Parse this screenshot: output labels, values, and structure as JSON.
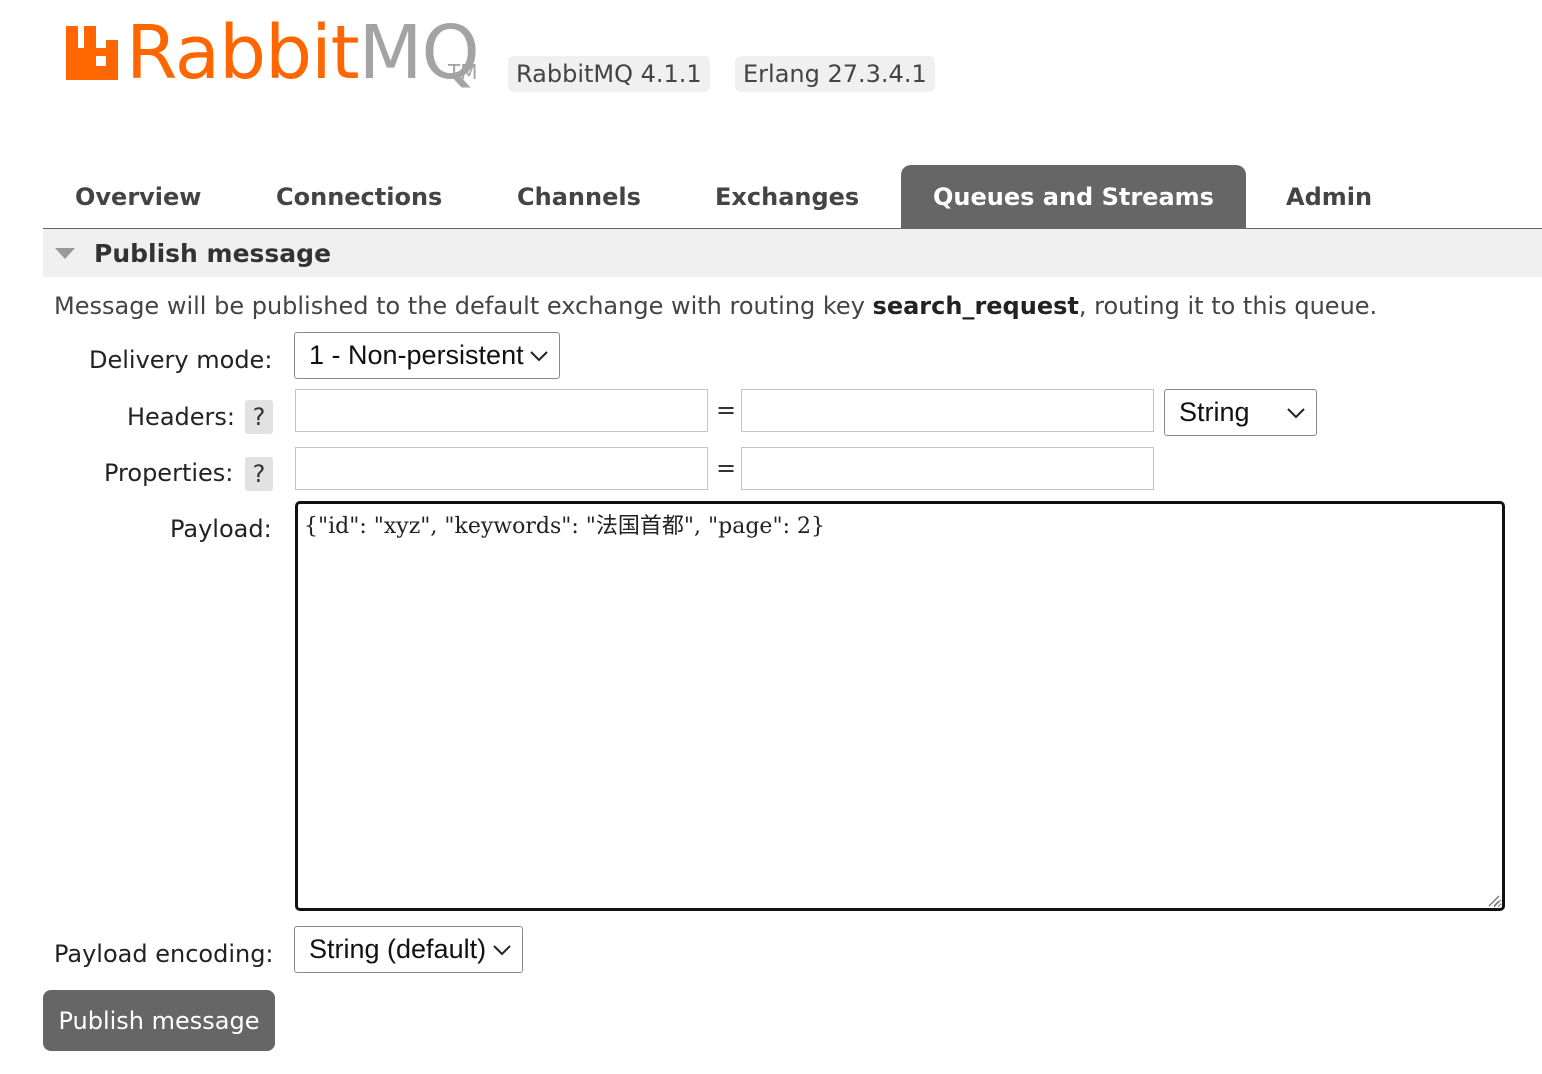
{
  "brand": {
    "rabbit": "Rabbit",
    "mq": "MQ",
    "tm": "TM",
    "primary_color": "#ff6600",
    "muted_color": "#a3a3a3"
  },
  "versions": {
    "rabbitmq": "RabbitMQ 4.1.1",
    "erlang": "Erlang 27.3.4.1"
  },
  "nav": {
    "tabs": [
      {
        "label": "Overview",
        "active": false
      },
      {
        "label": "Connections",
        "active": false
      },
      {
        "label": "Channels",
        "active": false
      },
      {
        "label": "Exchanges",
        "active": false
      },
      {
        "label": "Queues and Streams",
        "active": true
      },
      {
        "label": "Admin",
        "active": false
      }
    ],
    "active_color": "#666666"
  },
  "section": {
    "title": "Publish message",
    "info_prefix": "Message will be published to the default exchange with routing key ",
    "routing_key": "search_request",
    "info_suffix": ", routing it to this queue."
  },
  "form": {
    "delivery_mode_label": "Delivery mode:",
    "delivery_mode_value": "1 - Non-persistent",
    "headers_label": "Headers:",
    "help_glyph": "?",
    "headers_key": "",
    "headers_value": "",
    "equals": "=",
    "headers_type": "String",
    "properties_label": "Properties:",
    "properties_key": "",
    "properties_value": "",
    "payload_label": "Payload:",
    "payload_value": "{\"id\": \"xyz\", \"keywords\": \"法国首都\", \"page\": 2}",
    "payload_encoding_label": "Payload encoding:",
    "payload_encoding_value": "String (default)"
  },
  "actions": {
    "publish_label": "Publish message"
  }
}
